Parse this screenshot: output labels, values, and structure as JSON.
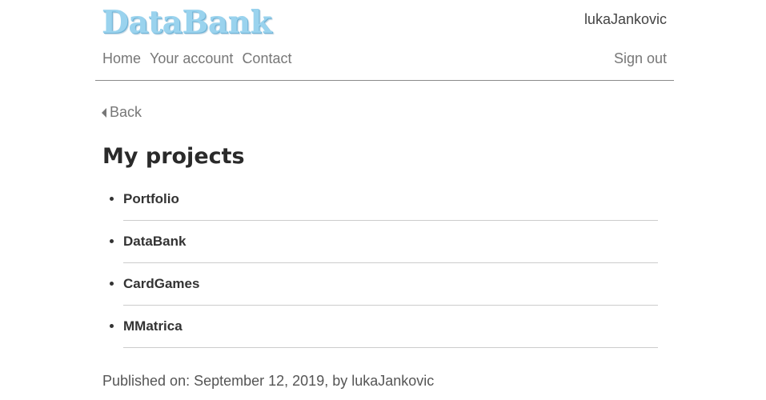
{
  "header": {
    "logo": "DataBank",
    "username": "lukaJankovic",
    "nav": [
      "Home",
      "Your account",
      "Contact"
    ],
    "sign_out": "Sign out"
  },
  "back_label": "Back",
  "page_title": "My projects",
  "projects": [
    "Portfolio",
    "DataBank",
    "CardGames",
    "MMatrica"
  ],
  "footer": {
    "published": "Published on: September 12, 2019, by lukaJankovic"
  },
  "colors": {
    "logo": "#9ad3ee",
    "link": "#777777",
    "text": "#333333",
    "divider": "#cccccc"
  }
}
